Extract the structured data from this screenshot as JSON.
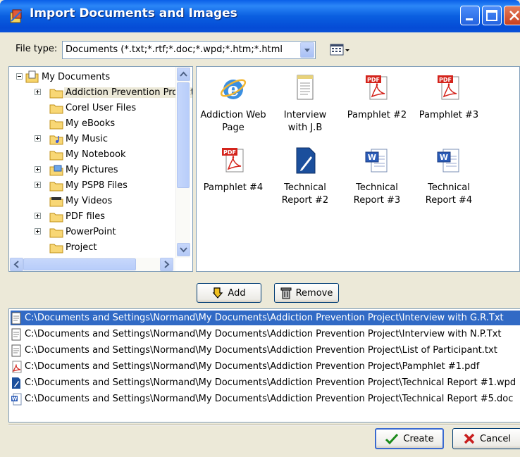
{
  "window": {
    "title": "Import Documents and Images"
  },
  "file_type": {
    "label": "File type:",
    "value": "Documents (*.txt;*.rtf;*.doc;*.wpd;*.htm;*.html"
  },
  "tree": {
    "root": "My Documents",
    "items": [
      "Addiction Prevention Project",
      "Corel User Files",
      "My eBooks",
      "My Music",
      "My Notebook",
      "My Pictures",
      "My PSP8 Files",
      "My Videos",
      "PDF files",
      "PowerPoint",
      "Project"
    ]
  },
  "files": [
    {
      "line1": "Addiction Web",
      "line2": "Page",
      "icon": "ie-icon"
    },
    {
      "line1": "Interview",
      "line2": "with J.B",
      "icon": "text-file-icon"
    },
    {
      "line1": "Pamphlet #2",
      "line2": "",
      "icon": "pdf-icon"
    },
    {
      "line1": "Pamphlet #3",
      "line2": "",
      "icon": "pdf-icon"
    },
    {
      "line1": "Pamphlet #4",
      "line2": "",
      "icon": "pdf-icon"
    },
    {
      "line1": "Technical",
      "line2": "Report #2",
      "icon": "wpd-icon"
    },
    {
      "line1": "Technical",
      "line2": "Report #3",
      "icon": "word-icon"
    },
    {
      "line1": "Technical",
      "line2": "Report #4",
      "icon": "word-icon"
    }
  ],
  "buttons": {
    "add": "Add",
    "remove": "Remove",
    "create": "Create",
    "cancel": "Cancel"
  },
  "import_list": [
    "C:\\Documents and Settings\\Normand\\My Documents\\Addiction Prevention Project\\Interview with G.R.Txt",
    "C:\\Documents and Settings\\Normand\\My Documents\\Addiction Prevention Project\\Interview with N.P.Txt",
    "C:\\Documents and Settings\\Normand\\My Documents\\Addiction Prevention Project\\List of Participant.txt",
    "C:\\Documents and Settings\\Normand\\My Documents\\Addiction Prevention Project\\Pamphlet #1.pdf",
    "C:\\Documents and Settings\\Normand\\My Documents\\Addiction Prevention Project\\Technical Report #1.wpd",
    "C:\\Documents and Settings\\Normand\\My Documents\\Addiction Prevention Project\\Technical Report #5.doc"
  ],
  "colors": {
    "titlebar": "#0a5fe8",
    "selection": "#316ac5",
    "dialog_bg": "#ece9d8"
  }
}
